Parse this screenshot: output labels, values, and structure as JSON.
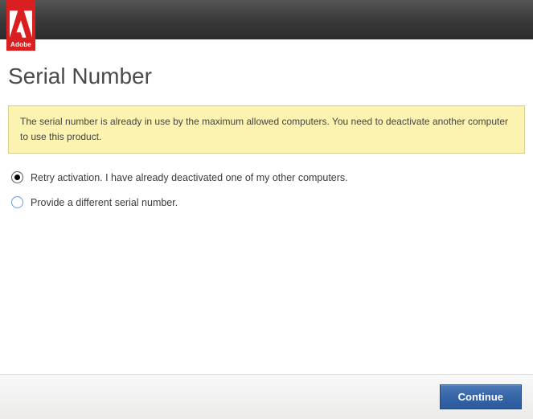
{
  "header": {
    "brand_name": "Adobe"
  },
  "page": {
    "title": "Serial Number"
  },
  "alert": {
    "message": "The serial number is already in use by the maximum allowed computers. You need to deactivate another computer to use this product."
  },
  "options": {
    "retry": {
      "label": "Retry activation. I have already deactivated one of my other computers.",
      "selected": true
    },
    "provide": {
      "label": "Provide a different serial number.",
      "selected": false
    }
  },
  "footer": {
    "continue_label": "Continue"
  }
}
